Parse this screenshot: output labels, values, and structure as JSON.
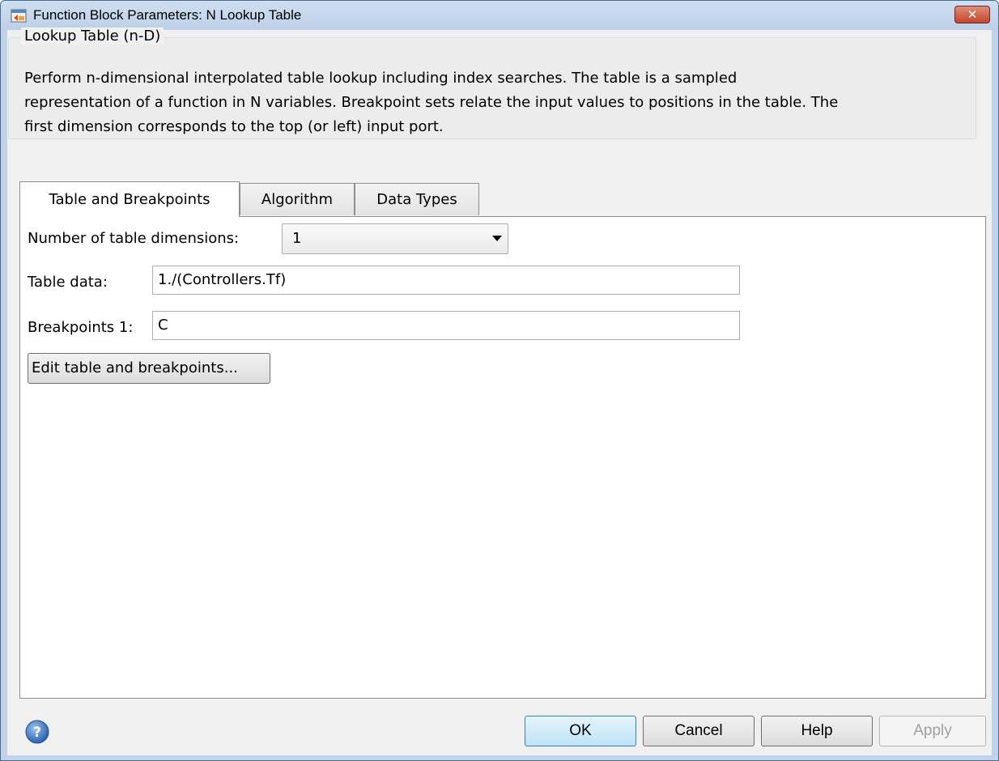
{
  "window": {
    "title": "Function Block Parameters: N Lookup Table",
    "close_label": "✕"
  },
  "description": {
    "group_title": "Lookup Table (n-D)",
    "lines": [
      "Perform n-dimensional interpolated table lookup including index searches. The table is a sampled",
      "representation of a function in N variables. Breakpoint sets relate the input values to positions in the table. The",
      "first dimension corresponds to the top (or left) input port."
    ]
  },
  "tabs": [
    {
      "label": "Table and Breakpoints",
      "selected": true
    },
    {
      "label": "Algorithm",
      "selected": false
    },
    {
      "label": "Data Types",
      "selected": false
    }
  ],
  "params": {
    "dimensions_label": "Number of table dimensions:",
    "dimensions_value": "1",
    "table_data_label": "Table data:",
    "table_data_value": "1./(Controllers.Tf)",
    "breakpoints1_label": "Breakpoints 1:",
    "breakpoints1_value": "C",
    "edit_button_label": "Edit table and breakpoints..."
  },
  "footer": {
    "ok_label": "OK",
    "cancel_label": "Cancel",
    "help_label": "Help",
    "apply_label": "Apply",
    "apply_enabled": false
  },
  "icons": {
    "app": "simulink-block-icon",
    "help": "help-question-icon"
  },
  "colors": {
    "title_bar": "#bfd3ea",
    "ok_accent": "#3c7fb1",
    "close_button": "#c4442a"
  }
}
